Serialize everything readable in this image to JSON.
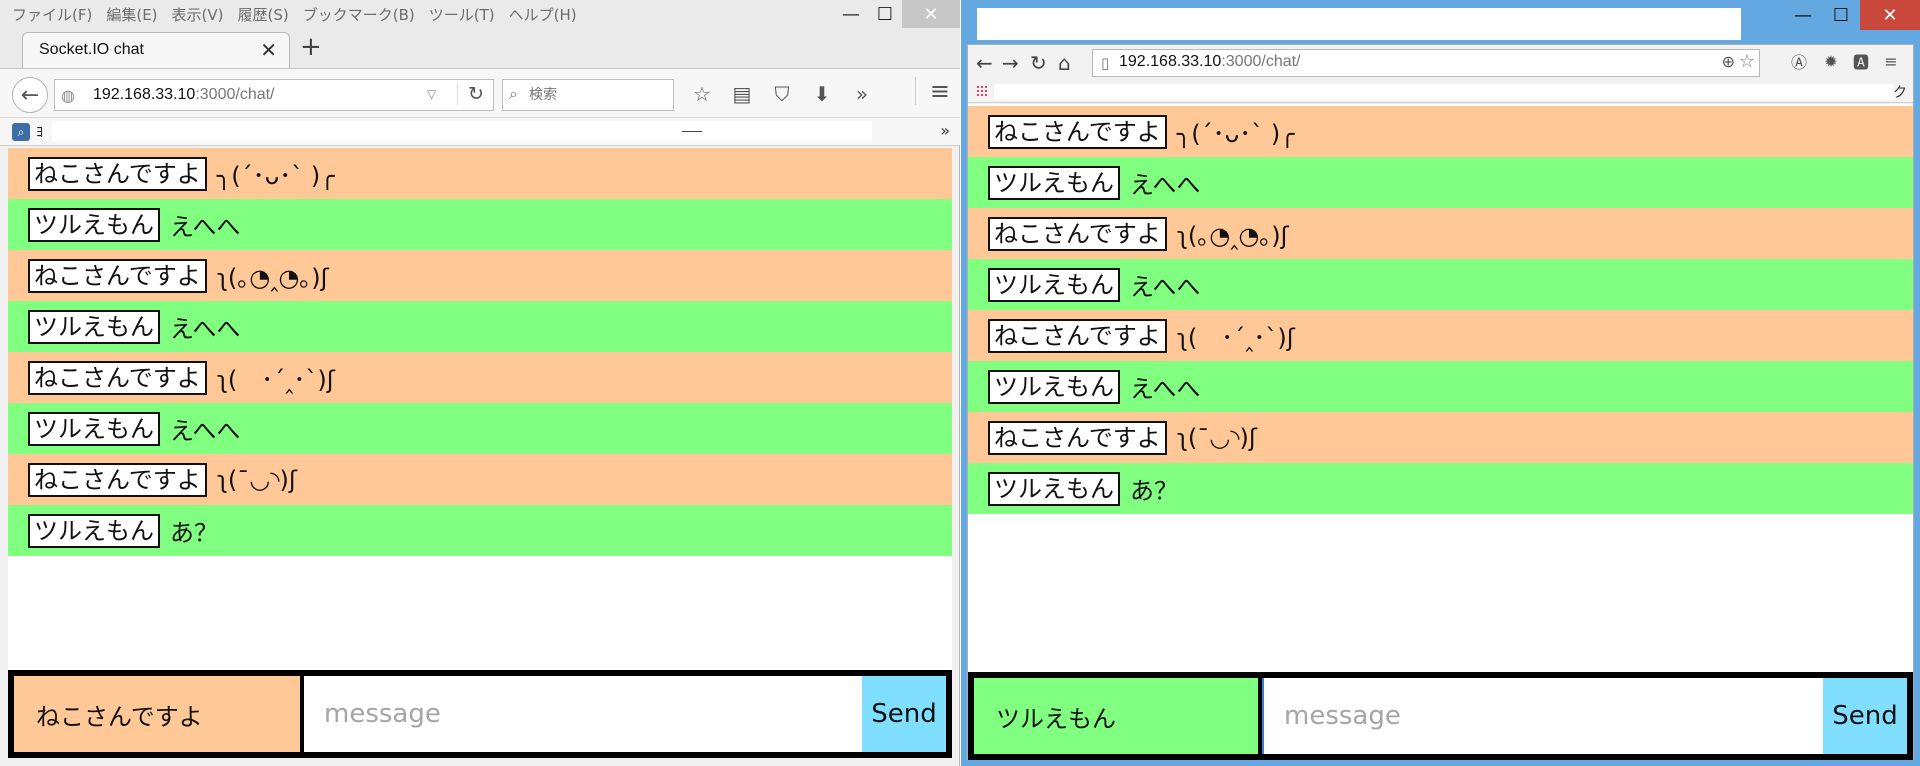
{
  "firefox": {
    "menu": [
      "ファイル(F)",
      "編集(E)",
      "表示(V)",
      "履歴(S)",
      "ブックマーク(B)",
      "ツール(T)",
      "ヘルプ(H)"
    ],
    "tab_title": "Socket.IO chat",
    "url_host": "192.168.33.10",
    "url_rest": ":3000/chat/",
    "search_placeholder": "検索",
    "bookmark_item": "ﾖ",
    "current_user": "ねこさんですよ",
    "message_placeholder": "message",
    "send_label": "Send"
  },
  "chrome": {
    "url_host": "192.168.33.10",
    "url_rest": ":3000/chat/",
    "bookmark_end": "ク",
    "current_user": "ツルえもん",
    "message_placeholder": "message",
    "send_label": "Send"
  },
  "messages": [
    {
      "nick": "ねこさんですよ",
      "text": "╮(´･ᴗ･` )╭",
      "type": "cat"
    },
    {
      "nick": "ツルえもん",
      "text": "えへへ",
      "type": "tsuru"
    },
    {
      "nick": "ねこさんですよ",
      "text": "ʅ(｡◔‸◔｡)ʃ",
      "type": "cat"
    },
    {
      "nick": "ツルえもん",
      "text": "えへへ",
      "type": "tsuru"
    },
    {
      "nick": "ねこさんですよ",
      "text": "ʅ(　･´‸･`)ʃ",
      "type": "cat"
    },
    {
      "nick": "ツルえもん",
      "text": "えへへ",
      "type": "tsuru"
    },
    {
      "nick": "ねこさんですよ",
      "text": "ʅ(¯◡◝)ʃ",
      "type": "cat"
    },
    {
      "nick": "ツルえもん",
      "text": "あ？",
      "type": "tsuru"
    }
  ],
  "colors": {
    "cat": "#ffc896",
    "tsuru": "#80ff80",
    "send": "#80dfff"
  }
}
